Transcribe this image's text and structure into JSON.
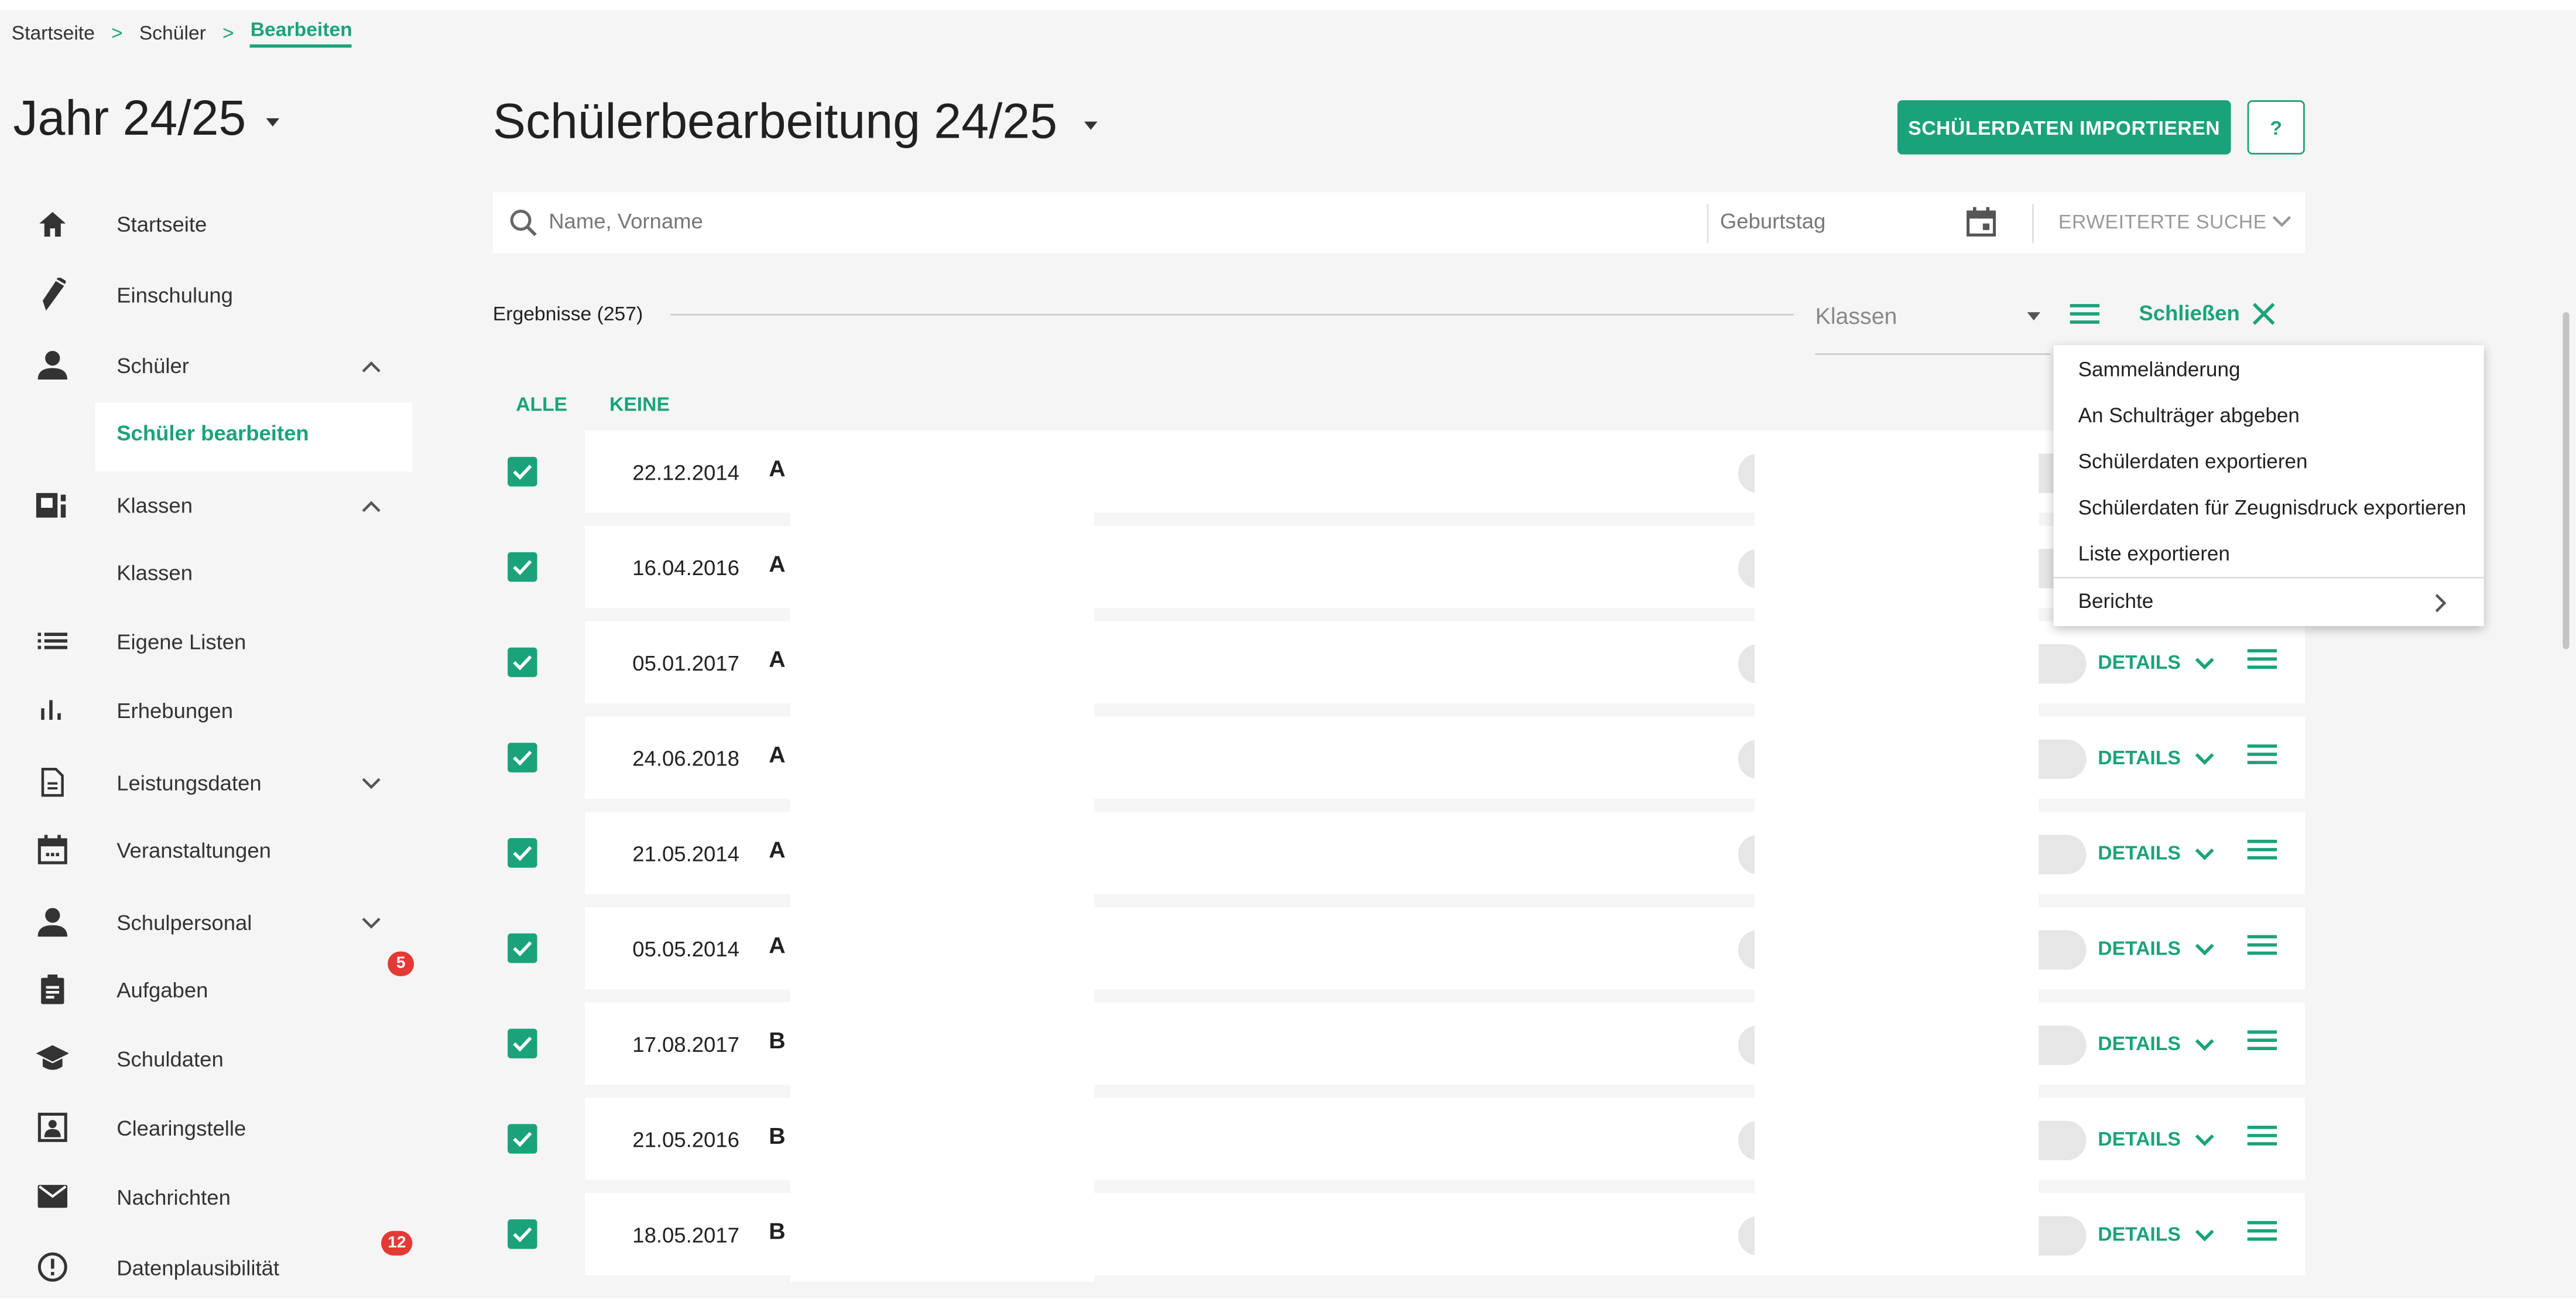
{
  "breadcrumb": {
    "home": "Startseite",
    "students": "Schüler",
    "current": "Bearbeiten"
  },
  "sidebar": {
    "year": "Jahr 24/25",
    "items": [
      {
        "label": "Startseite",
        "icon": "home-icon"
      },
      {
        "label": "Einschulung",
        "icon": "pen-icon"
      },
      {
        "label": "Schüler",
        "icon": "person-icon"
      },
      {
        "label": "Schüler bearbeiten",
        "icon": ""
      },
      {
        "label": "Klassen",
        "icon": "class-icon"
      },
      {
        "label": "Klassen",
        "icon": ""
      },
      {
        "label": "Eigene Listen",
        "icon": "list-icon"
      },
      {
        "label": "Erhebungen",
        "icon": "chart-icon"
      },
      {
        "label": "Leistungsdaten",
        "icon": "document-icon"
      },
      {
        "label": "Veranstaltungen",
        "icon": "calendar-icon"
      },
      {
        "label": "Schulpersonal",
        "icon": "person-icon"
      },
      {
        "label": "Aufgaben",
        "icon": "clipboard-icon"
      },
      {
        "label": "Schuldaten",
        "icon": "school-icon"
      },
      {
        "label": "Clearingstelle",
        "icon": "clearing-icon"
      },
      {
        "label": "Nachrichten",
        "icon": "mail-icon"
      },
      {
        "label": "Datenplausibilität",
        "icon": "alert-icon"
      }
    ],
    "badges": {
      "aufgaben": "5",
      "datenplausibilitaet": "12"
    }
  },
  "header": {
    "title": "Schülerbearbeitung 24/25",
    "import_label": "SCHÜLERDATEN IMPORTIEREN",
    "help_label": "?"
  },
  "search": {
    "placeholder": "Name, Vorname",
    "birthday_placeholder": "Geburtstag",
    "extended_label": "ERWEITERTE SUCHE"
  },
  "results": {
    "label": "Ergebnisse (257)",
    "classes_filter": "Klassen",
    "close_label": "Schließen",
    "select_all": "ALLE",
    "select_none": "KEINE"
  },
  "rows": [
    {
      "date": "22.12.2014",
      "initial": "A",
      "details": ""
    },
    {
      "date": "16.04.2016",
      "initial": "A",
      "details": ""
    },
    {
      "date": "05.01.2017",
      "initial": "A",
      "details": "DETAILS"
    },
    {
      "date": "24.06.2018",
      "initial": "A",
      "details": "DETAILS"
    },
    {
      "date": "21.05.2014",
      "initial": "A",
      "details": "DETAILS"
    },
    {
      "date": "05.05.2014",
      "initial": "A",
      "details": "DETAILS"
    },
    {
      "date": "17.08.2017",
      "initial": "B",
      "details": "DETAILS"
    },
    {
      "date": "21.05.2016",
      "initial": "B",
      "details": "DETAILS"
    },
    {
      "date": "18.05.2017",
      "initial": "B",
      "details": "DETAILS"
    }
  ],
  "menu": {
    "items": [
      "Sammeländerung",
      "An Schulträger abgeben",
      "Schülerdaten exportieren",
      "Schülerdaten für Zeugnisdruck exportieren",
      "Liste exportieren",
      "Berichte"
    ]
  },
  "colors": {
    "accent": "#1aa37a",
    "badge": "#e53935",
    "background": "#f5f5f5"
  }
}
